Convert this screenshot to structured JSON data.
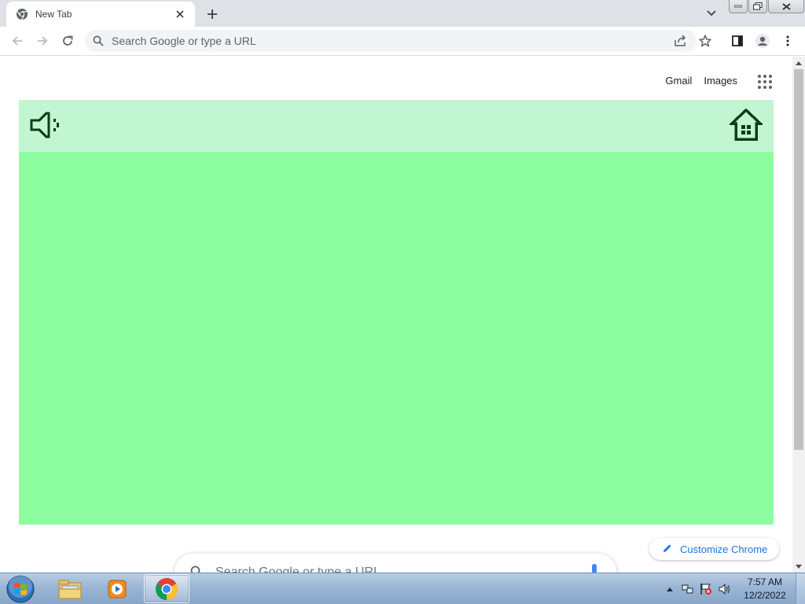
{
  "browser": {
    "tab": {
      "title": "New Tab",
      "favicon": "chrome-icon"
    },
    "omnibox": {
      "placeholder": "Search Google or type a URL",
      "value": ""
    }
  },
  "page": {
    "top_links": {
      "gmail": "Gmail",
      "images": "Images"
    },
    "game": {
      "background_color": "#8dfea0",
      "bar_color": "#c2f6d2",
      "icon_color": "#0f3d1a",
      "left_icon": "speaker-icon",
      "right_icon": "home-icon"
    },
    "customize_label": "Customize Chrome",
    "search": {
      "placeholder": "Search Google or type a URL"
    }
  },
  "taskbar": {
    "clock_time": "7:57 AM",
    "clock_date": "12/2/2022",
    "items": [
      "file-explorer-icon",
      "media-player-icon",
      "chrome-icon"
    ]
  },
  "colors": {
    "accent": "#1a73e8",
    "tab_strip": "#dee1e6"
  }
}
